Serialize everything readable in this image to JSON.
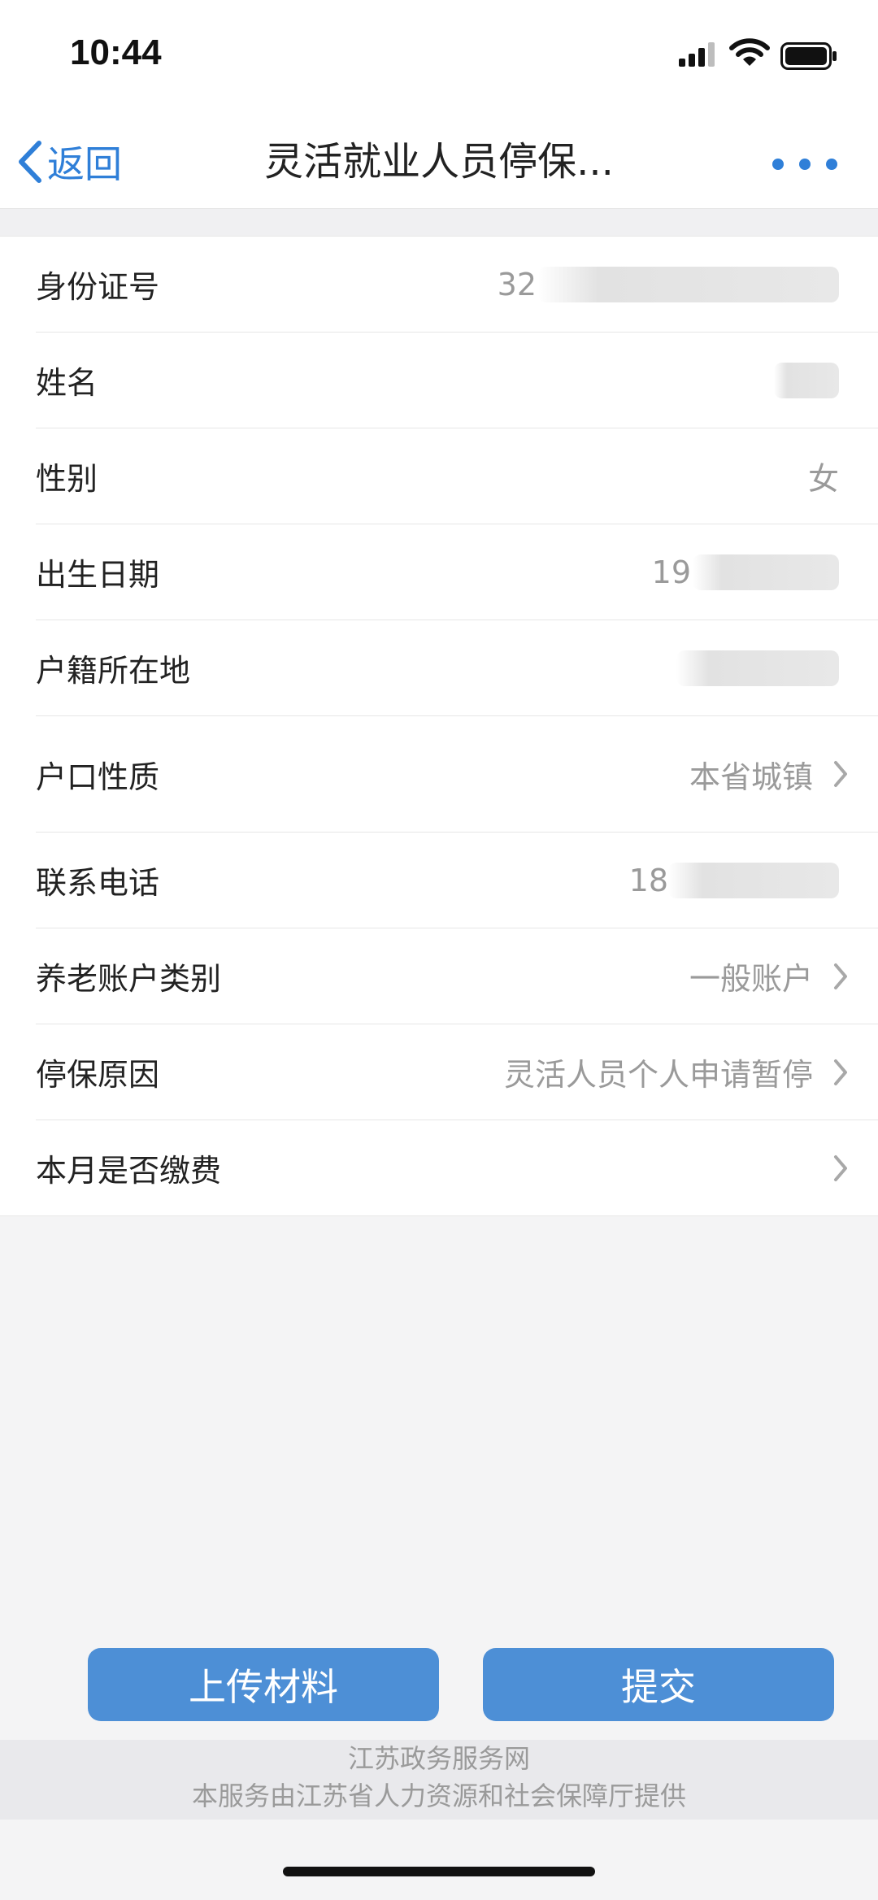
{
  "status_bar": {
    "time": "10:44"
  },
  "nav": {
    "back_label": "返回",
    "title": "灵活就业人员停保..."
  },
  "form": {
    "rows": [
      {
        "label": "身份证号",
        "value": "32"
      },
      {
        "label": "姓名",
        "value": ""
      },
      {
        "label": "性别",
        "value": "女"
      },
      {
        "label": "出生日期",
        "value": "19"
      },
      {
        "label": "户籍所在地",
        "value": ""
      },
      {
        "label": "户口性质",
        "value": "本省城镇"
      },
      {
        "label": "联系电话",
        "value": "18"
      },
      {
        "label": "养老账户类别",
        "value": "一般账户"
      },
      {
        "label": "停保原因",
        "value": "灵活人员个人申请暂停"
      },
      {
        "label": "本月是否缴费",
        "value": ""
      }
    ]
  },
  "actions": {
    "upload_label": "上传材料",
    "submit_label": "提交"
  },
  "footer": {
    "line1": "江苏政务服务网",
    "line2": "本服务由江苏省人力资源和社会保障厅提供"
  },
  "colors": {
    "accent": "#2f7fd8",
    "button": "#4d8fd6"
  }
}
